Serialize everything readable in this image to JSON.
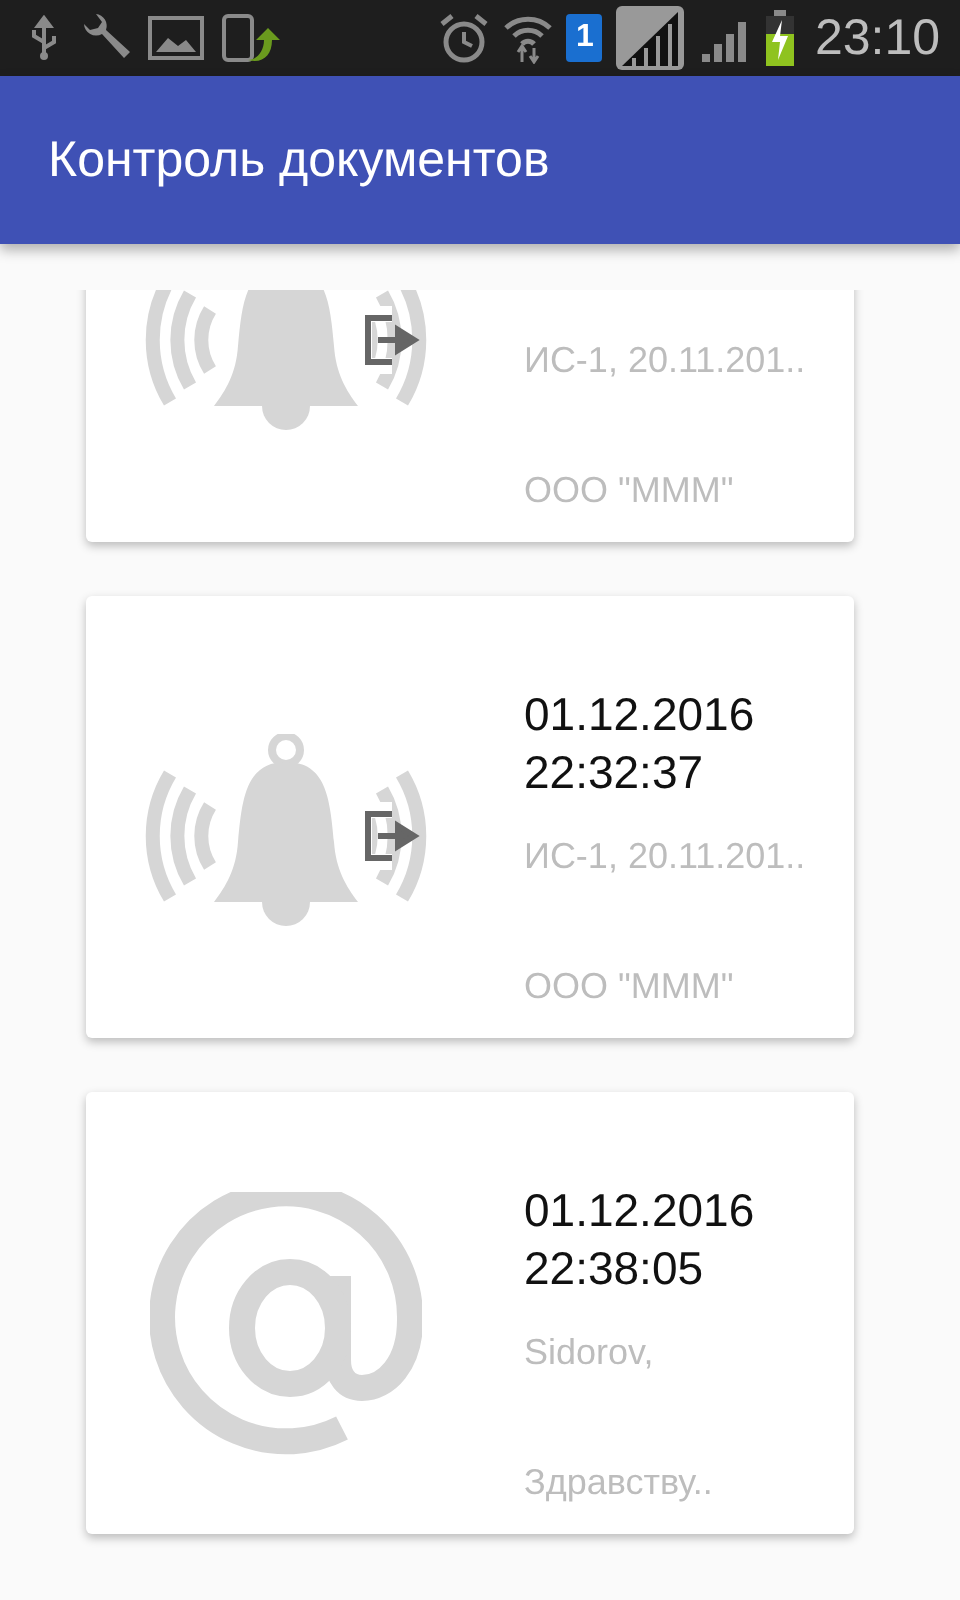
{
  "status_bar": {
    "sim_label": "1",
    "time": "23:10"
  },
  "app_bar": {
    "title": "Контроль документов"
  },
  "documents": [
    {
      "kind": "bell",
      "info": "ИС-1, 20.11.201..",
      "sender": "ООО \"МММ\""
    },
    {
      "kind": "bell",
      "date": "01.12.2016",
      "time": "22:32:37",
      "info": "ИС-1, 20.11.201..",
      "sender": "ООО \"МММ\""
    },
    {
      "kind": "email",
      "date": "01.12.2016",
      "time": "22:38:05",
      "info": "Sidorov,",
      "sender": "Здравству.."
    }
  ]
}
